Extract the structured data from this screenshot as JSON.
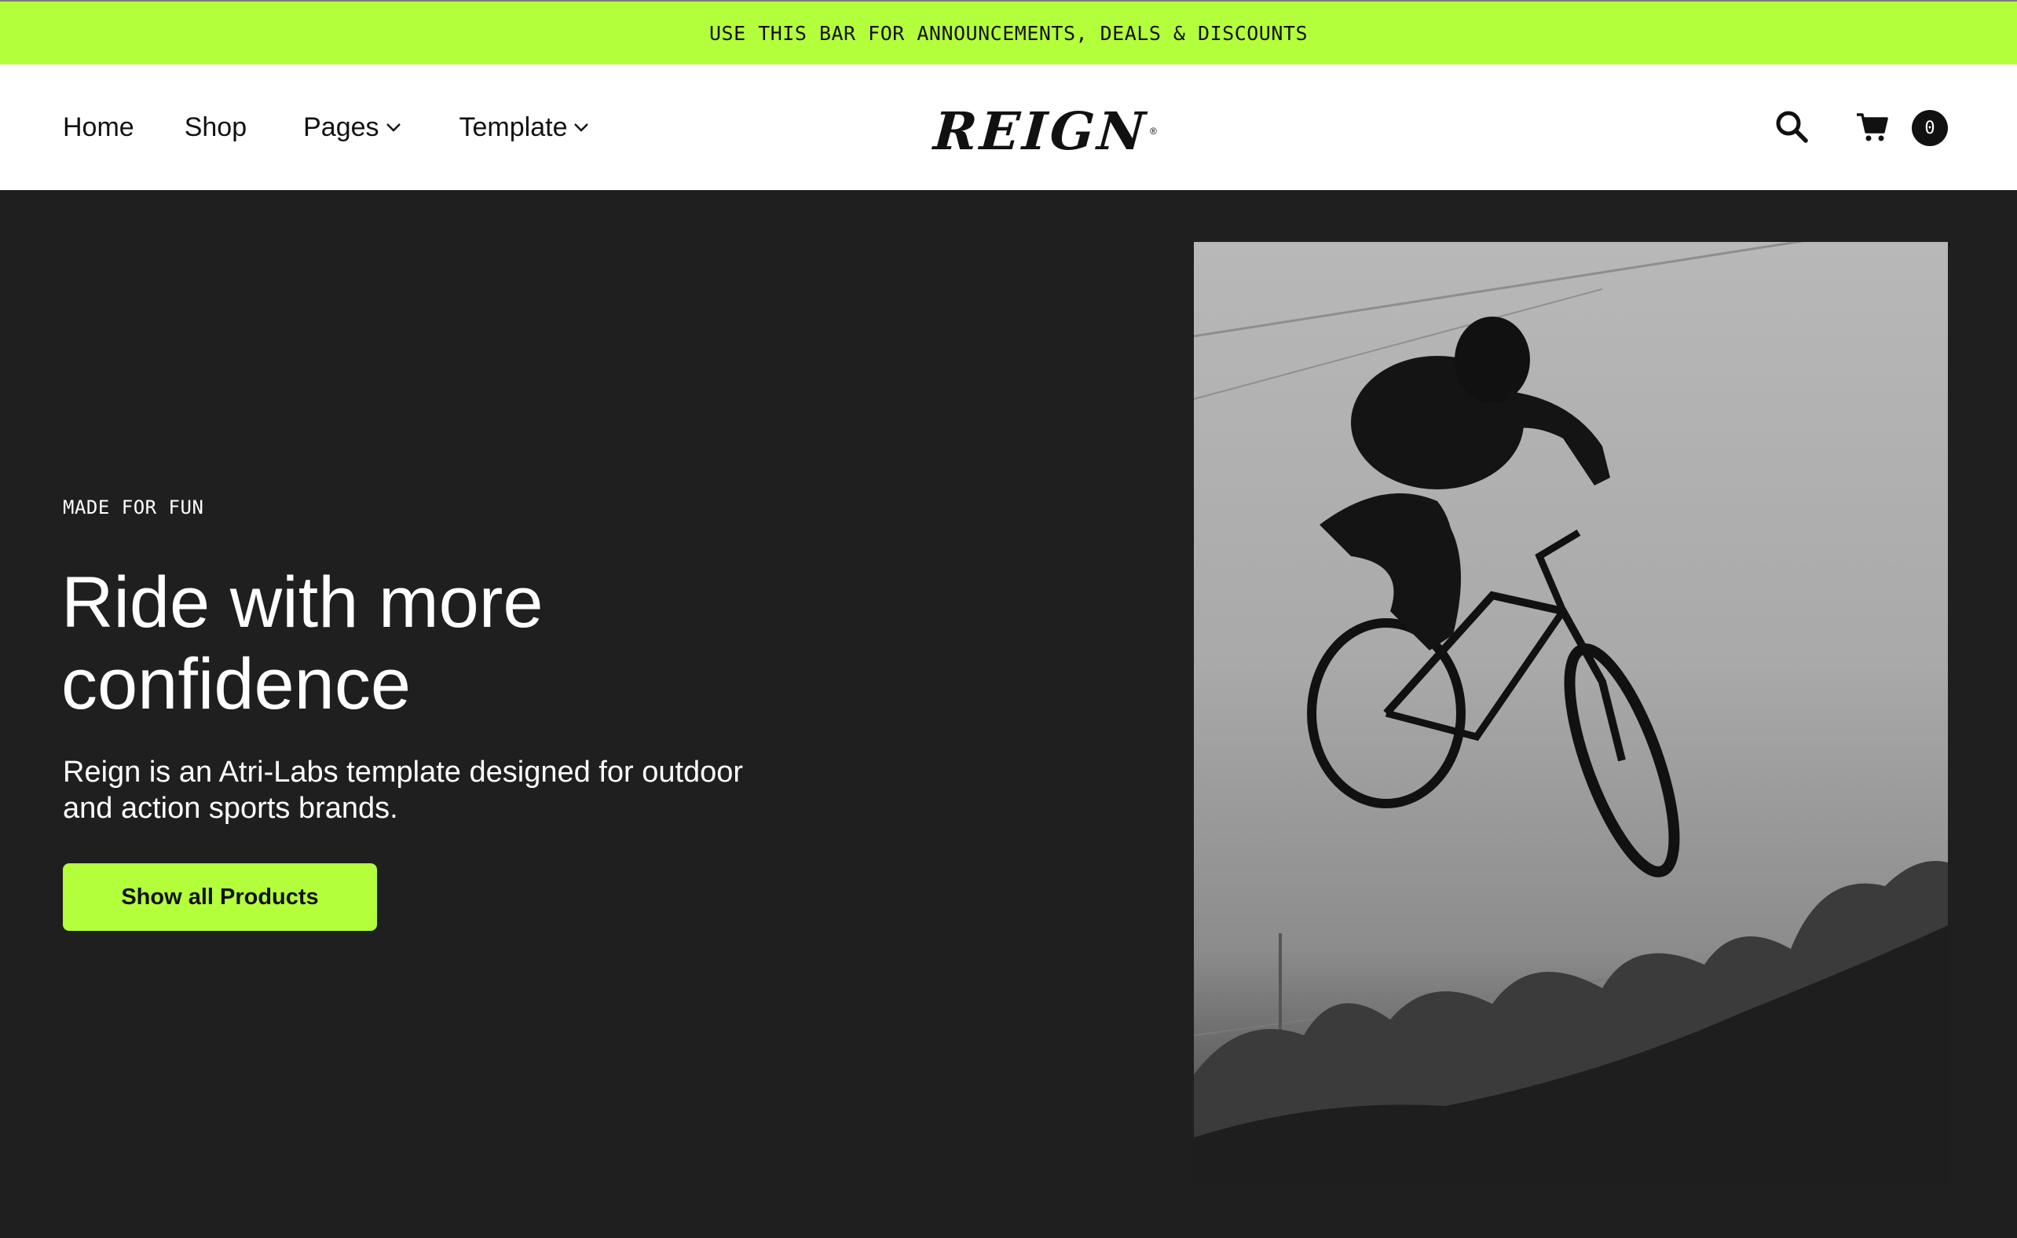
{
  "announcement": {
    "text": "USE THIS BAR FOR ANNOUNCEMENTS, DEALS & DISCOUNTS"
  },
  "nav": {
    "items": [
      {
        "label": "Home",
        "has_dropdown": false
      },
      {
        "label": "Shop",
        "has_dropdown": false
      },
      {
        "label": "Pages",
        "has_dropdown": true
      },
      {
        "label": "Template",
        "has_dropdown": true
      }
    ]
  },
  "brand": {
    "logo_text": "REIGN",
    "logo_mark": "®"
  },
  "header_actions": {
    "search_icon": "search-icon",
    "cart_icon": "cart-icon",
    "cart_count": "0"
  },
  "hero": {
    "eyebrow": "MADE FOR FUN",
    "headline": "Ride with more confidence",
    "description": "Reign is an Atri-Labs template designed for outdoor and action sports brands.",
    "cta_label": "Show all Products",
    "image_alt": "Black and white photo of a rider jumping a BMX bike against the sky"
  },
  "colors": {
    "accent": "#b4ff3c",
    "dark_bg": "#1f1f1f",
    "text_dark": "#111111",
    "header_bg": "#ffffff"
  }
}
